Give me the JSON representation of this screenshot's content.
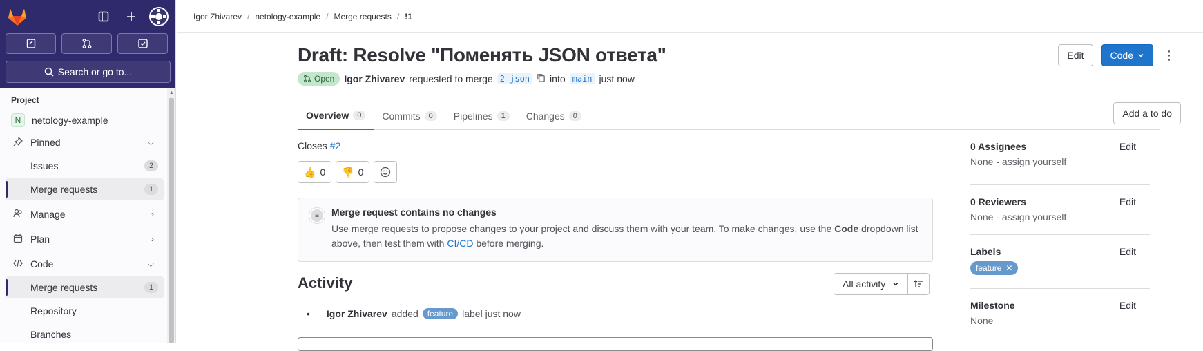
{
  "sidebar": {
    "search_label": "Search or go to...",
    "section_title": "Project",
    "project_initial": "N",
    "project_name": "netology-example",
    "pinned_label": "Pinned",
    "issues_label": "Issues",
    "issues_count": "2",
    "pinned_mr_label": "Merge requests",
    "pinned_mr_count": "1",
    "manage_label": "Manage",
    "plan_label": "Plan",
    "code_label": "Code",
    "code_mr_label": "Merge requests",
    "code_mr_count": "1",
    "repository_label": "Repository",
    "next_label": "Branches"
  },
  "breadcrumb": {
    "user": "Igor Zhivarev",
    "project": "netology-example",
    "section": "Merge requests",
    "current": "!1"
  },
  "mr": {
    "title": "Draft: Resolve \"Поменять JSON ответа\"",
    "status": "Open",
    "author": "Igor Zhivarev",
    "requested_text": "requested to merge",
    "source_branch": "2-json",
    "into_text": "into",
    "target_branch": "main",
    "time": "just now"
  },
  "header_buttons": {
    "edit": "Edit",
    "code": "Code"
  },
  "tabs": [
    {
      "label": "Overview",
      "count": "0"
    },
    {
      "label": "Commits",
      "count": "0"
    },
    {
      "label": "Pipelines",
      "count": "1"
    },
    {
      "label": "Changes",
      "count": "0"
    }
  ],
  "todo_button": "Add a to do",
  "closes": {
    "text": "Closes",
    "issue": "#2"
  },
  "reactions": {
    "thumbs_up": "0",
    "thumbs_down": "0"
  },
  "alert": {
    "title": "Merge request contains no changes",
    "text_1": "Use merge requests to propose changes to your project and discuss them with your team. To make changes, use the",
    "text_code": "Code",
    "text_2": "dropdown list above, then test them with",
    "text_link": "CI/CD",
    "text_3": "before merging."
  },
  "activity": {
    "title": "Activity",
    "filter": "All activity",
    "item_author": "Igor Zhivarev",
    "item_action": "added",
    "item_label": "feature",
    "item_suffix": "label just now"
  },
  "right_sidebar": {
    "assignees_title": "0 Assignees",
    "assignees_value": "None - assign yourself",
    "reviewers_title": "0 Reviewers",
    "reviewers_value": "None - assign yourself",
    "labels_title": "Labels",
    "label_chip": "feature",
    "milestone_title": "Milestone",
    "milestone_value": "None",
    "edit_label": "Edit"
  },
  "colors": {
    "sidebar_top": "#2f2a6b",
    "accent": "#1f75cb",
    "label": "#6699cc",
    "status_bg": "#c3e6cd"
  }
}
